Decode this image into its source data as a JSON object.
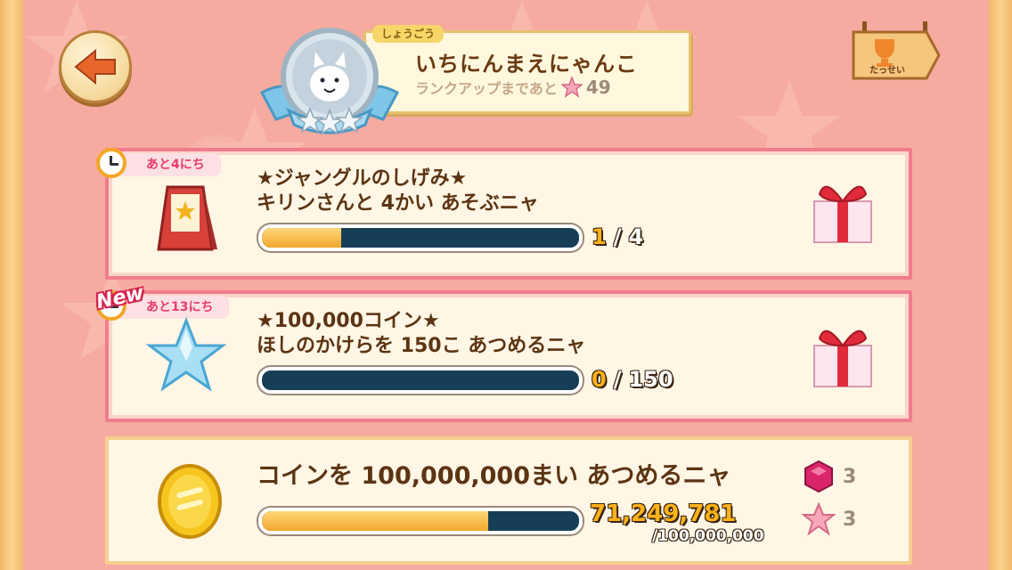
{
  "header": {
    "title_tag": "しょうごう",
    "title_name": "いちにんまえにゃんこ",
    "rank_up_label": "ランクアップまであと",
    "rank_up_value": "49",
    "achievement_label": "たっせい"
  },
  "missions": [
    {
      "days_left": "あと4にち",
      "title": "★ジャングルのしげみ★",
      "description": "キリンさんと 4かい あそぶニャ",
      "current": "1",
      "total": "4",
      "progress": 0.25,
      "is_new": false
    },
    {
      "days_left": "あと13にち",
      "title": "★100,000コイン★",
      "description": "ほしのかけらを 150こ あつめるニャ",
      "current": "0",
      "total": "150",
      "progress": 0.0,
      "is_new": true,
      "new_label": "New"
    }
  ],
  "main_goal": {
    "description": "コインを 100,000,000まい あつめるニャ",
    "current": "71,249,781",
    "total": "/100,000,000",
    "progress": 0.7125,
    "rewards": [
      {
        "icon": "gem-icon",
        "count": "3"
      },
      {
        "icon": "star-icon",
        "count": "3"
      }
    ]
  },
  "colors": {
    "background": "#f6aaa0",
    "card_border": "#f07c8d",
    "progress_fill": "#f2a62c",
    "progress_track": "#173e57",
    "text_brown": "#5c3413"
  }
}
